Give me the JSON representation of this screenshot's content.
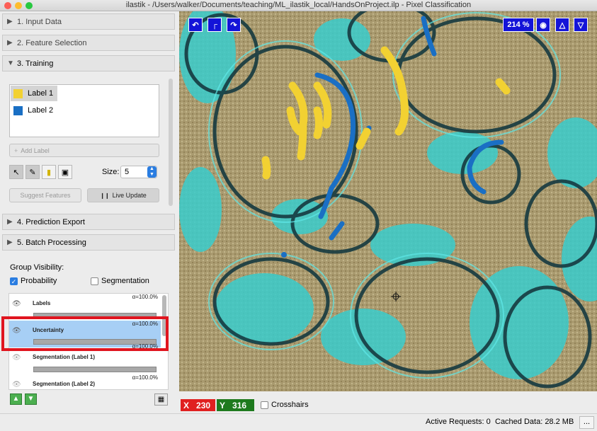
{
  "window": {
    "title": "ilastik - /Users/walker/Documents/teaching/ML_ilastik_local/HandsOnProject.ilp - Pixel Classification"
  },
  "applets": {
    "input_data": "1. Input Data",
    "feature_selection": "2. Feature Selection",
    "training": "3. Training",
    "prediction_export": "4. Prediction Export",
    "batch_processing": "5. Batch Processing"
  },
  "training": {
    "labels": [
      {
        "name": "Label 1",
        "color": "#f2d132"
      },
      {
        "name": "Label 2",
        "color": "#1a6fc4"
      }
    ],
    "add_label": "Add Label",
    "size_label": "Size:",
    "size_value": "5",
    "suggest_features": "Suggest Features",
    "live_update": "Live Update"
  },
  "group_visibility": {
    "title": "Group Visibility:",
    "probability": "Probability",
    "segmentation": "Segmentation"
  },
  "layers": [
    {
      "name": "Labels",
      "alpha": "α=100.0%"
    },
    {
      "name": "Uncertainty",
      "alpha": "α=100.0%"
    },
    {
      "name": "Segmentation (Label 1)",
      "alpha": "α=100.0%"
    },
    {
      "name": "Segmentation (Label 2)",
      "alpha": "α=100.0%"
    }
  ],
  "viewer": {
    "zoom": "214 %"
  },
  "status": {
    "x_label": "X",
    "x_value": "230",
    "y_label": "Y",
    "y_value": "316",
    "crosshairs": "Crosshairs",
    "active_requests": "Active Requests: 0",
    "cached_data": "Cached Data: 28.2 MB",
    "more": "..."
  },
  "colors": {
    "highlight": "#e0151f",
    "selected_layer": "#a7cff5",
    "viewer_button": "#1414d8"
  }
}
